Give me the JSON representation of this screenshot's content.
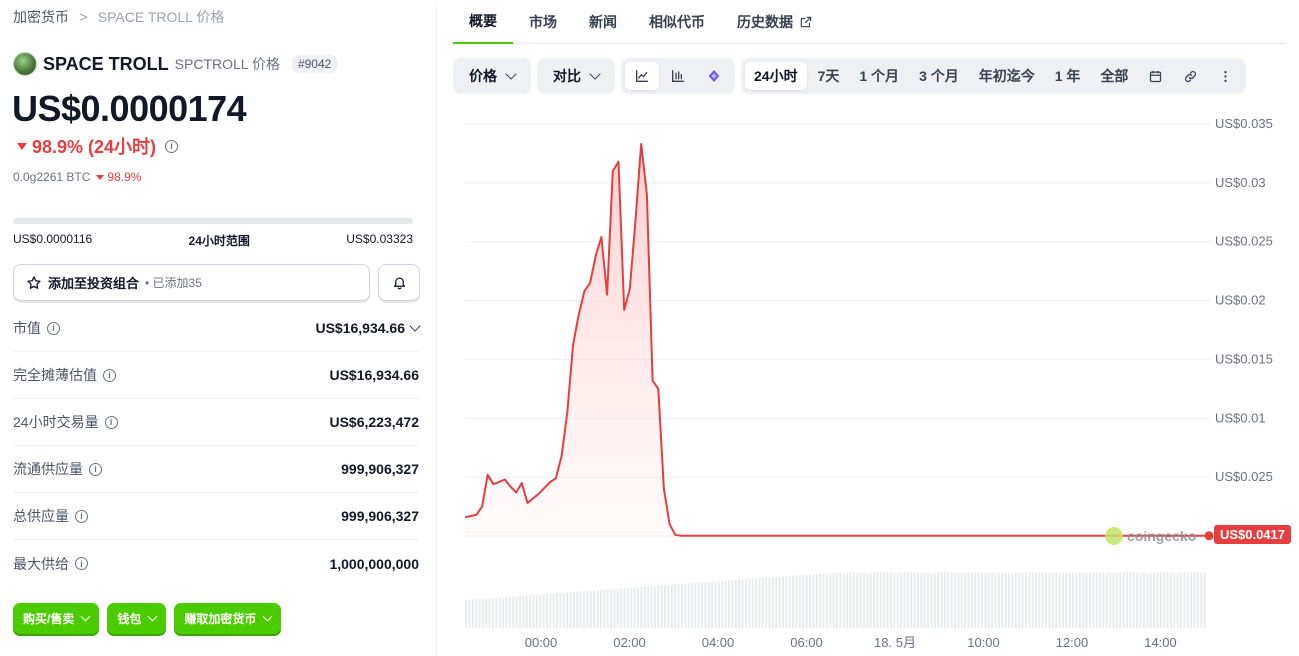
{
  "breadcrumb": {
    "root": "加密货币",
    "separator": ">",
    "current": "SPACE TROLL 价格"
  },
  "coin": {
    "name": "SPACE TROLL",
    "symbol_label": "SPCTROLL 价格",
    "rank": "#9042",
    "price": "US$0.0000174",
    "change_24h": "98.9% (24小时)",
    "btc_price": "0.0g2261 BTC",
    "btc_change": "98.9%"
  },
  "range": {
    "low": "US$0.0000116",
    "label": "24小时范围",
    "high": "US$0.03323"
  },
  "portfolio": {
    "label": "添加至投资组合",
    "added": "• 已添加35"
  },
  "stats": [
    {
      "label": "市值",
      "value": "US$16,934.66"
    },
    {
      "label": "完全摊薄估值",
      "value": "US$16,934.66"
    },
    {
      "label": "24小时交易量",
      "value": "US$6,223,472"
    },
    {
      "label": "流通供应量",
      "value": "999,906,327"
    },
    {
      "label": "总供应量",
      "value": "999,906,327"
    },
    {
      "label": "最大供给",
      "value": "1,000,000,000"
    }
  ],
  "actions": {
    "buy_sell": "购买/售卖",
    "wallet": "钱包",
    "earn": "赚取加密货币"
  },
  "tabs": [
    "概要",
    "市场",
    "新闻",
    "相似代币",
    "历史数据"
  ],
  "toolbar": {
    "price": "价格",
    "compare": "对比",
    "ranges": [
      "24小时",
      "7天",
      "1 个月",
      "3 个月",
      "年初迄今",
      "1 年",
      "全部"
    ]
  },
  "colors": {
    "accent": "#4bcc00",
    "down": "#e53e3e"
  },
  "chart_data": {
    "type": "area",
    "x_ticks": [
      "00:00",
      "02:00",
      "04:00",
      "06:00",
      "18. 5月",
      "10:00",
      "12:00",
      "14:00"
    ],
    "y_ticks": [
      "US$0.035",
      "US$0.03",
      "US$0.025",
      "US$0.02",
      "US$0.015",
      "US$0.01",
      "US$0.025",
      ""
    ],
    "ylim": [
      0,
      0.035
    ],
    "current_price_label": "US$0.0417",
    "watermark": "coingecko",
    "series": [
      {
        "values": [
          0.0016,
          0.0017,
          0.0018,
          0.0025,
          0.0052,
          0.0044,
          0.0046,
          0.0048,
          0.0042,
          0.0037,
          0.0045,
          0.0028,
          0.0032,
          0.0036,
          0.0041,
          0.0046,
          0.0049,
          0.0068,
          0.0105,
          0.0162,
          0.0188,
          0.0208,
          0.0215,
          0.0238,
          0.0254,
          0.0205,
          0.031,
          0.0318,
          0.0192,
          0.021,
          0.0268,
          0.0333,
          0.029,
          0.0132,
          0.0125,
          0.004,
          0.001,
          0.0001,
          2e-05,
          2e-05
        ]
      }
    ],
    "volume_bars": true
  }
}
